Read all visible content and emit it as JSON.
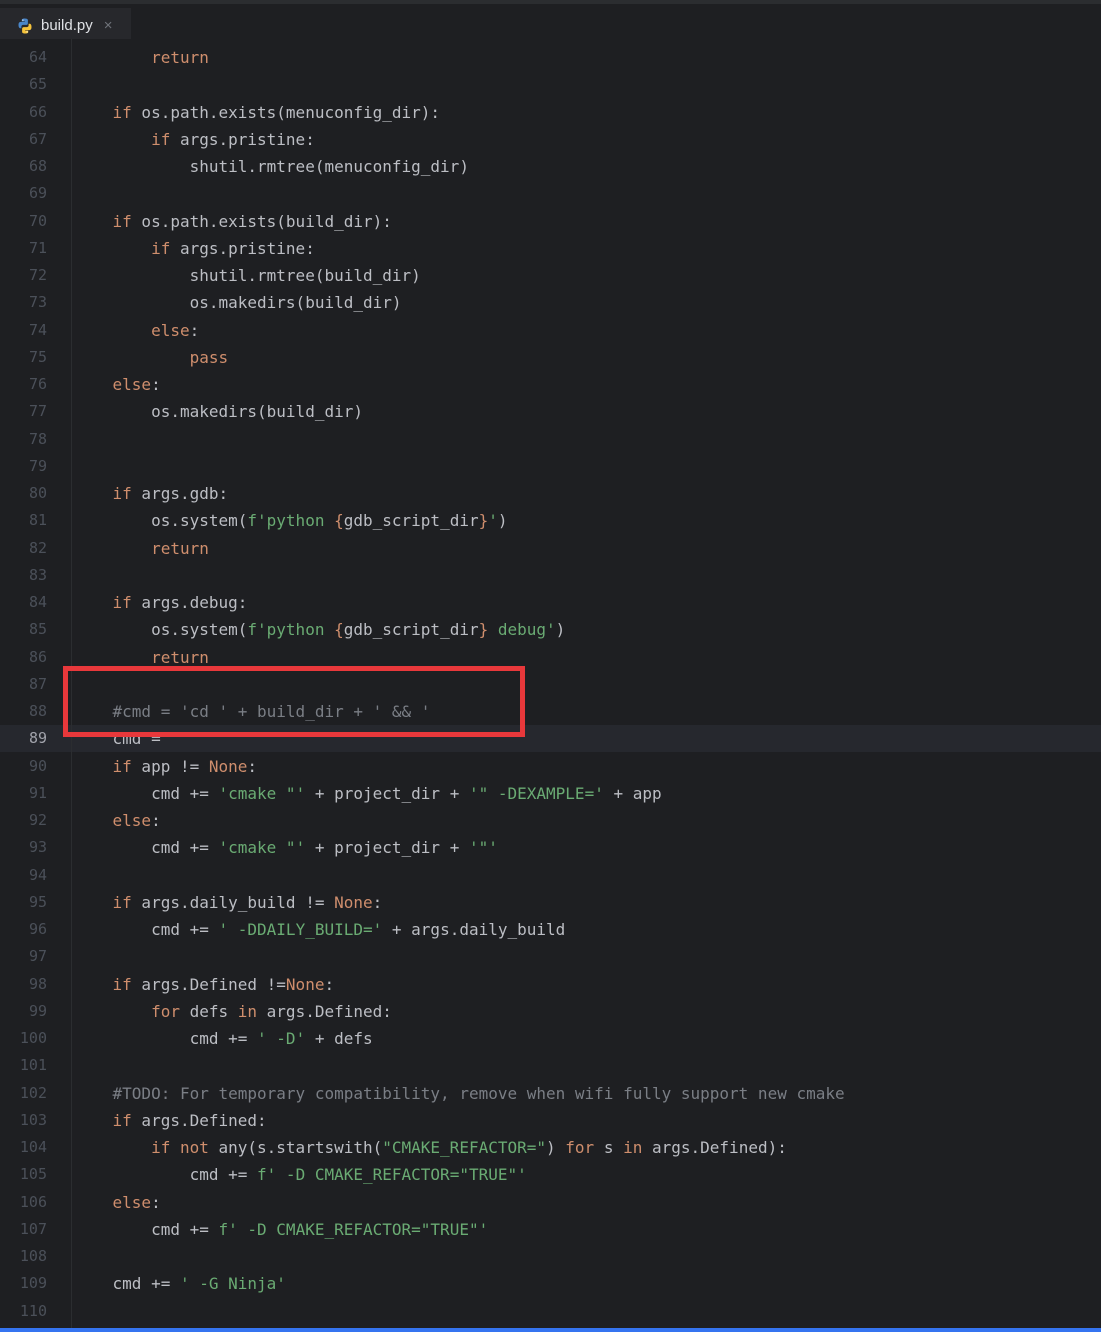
{
  "tab": {
    "file_name": "build.py",
    "close_glyph": "×",
    "icon": "python-icon"
  },
  "editor": {
    "current_line": 89,
    "lines": [
      {
        "n": "64",
        "code": [
          [
            "kw",
            "        return"
          ]
        ]
      },
      {
        "n": "65",
        "code": []
      },
      {
        "n": "66",
        "code": [
          [
            "kw",
            "    if"
          ],
          [
            "op",
            " os.path.exists(menuconfig_dir):"
          ]
        ]
      },
      {
        "n": "67",
        "code": [
          [
            "kw",
            "        if"
          ],
          [
            "op",
            " args.pristine:"
          ]
        ]
      },
      {
        "n": "68",
        "code": [
          [
            "op",
            "            shutil.rmtree(menuconfig_dir)"
          ]
        ]
      },
      {
        "n": "69",
        "code": []
      },
      {
        "n": "70",
        "code": [
          [
            "kw",
            "    if"
          ],
          [
            "op",
            " os.path.exists(build_dir):"
          ]
        ]
      },
      {
        "n": "71",
        "code": [
          [
            "kw",
            "        if"
          ],
          [
            "op",
            " args.pristine:"
          ]
        ]
      },
      {
        "n": "72",
        "code": [
          [
            "op",
            "            shutil.rmtree(build_dir)"
          ]
        ]
      },
      {
        "n": "73",
        "code": [
          [
            "op",
            "            os.makedirs(build_dir)"
          ]
        ]
      },
      {
        "n": "74",
        "code": [
          [
            "kw",
            "        else"
          ],
          [
            "op",
            ":"
          ]
        ]
      },
      {
        "n": "75",
        "code": [
          [
            "kw",
            "            pass"
          ]
        ]
      },
      {
        "n": "76",
        "code": [
          [
            "kw",
            "    else"
          ],
          [
            "op",
            ":"
          ]
        ]
      },
      {
        "n": "77",
        "code": [
          [
            "op",
            "        os.makedirs(build_dir)"
          ]
        ]
      },
      {
        "n": "78",
        "code": []
      },
      {
        "n": "79",
        "code": []
      },
      {
        "n": "80",
        "code": [
          [
            "kw",
            "    if"
          ],
          [
            "op",
            " args.gdb:"
          ]
        ]
      },
      {
        "n": "81",
        "code": [
          [
            "op",
            "        os.system("
          ],
          [
            "str",
            "f'python "
          ],
          [
            "kw",
            "{"
          ],
          [
            "op",
            "gdb_script_dir"
          ],
          [
            "kw",
            "}"
          ],
          [
            "str",
            "'"
          ],
          [
            "op",
            ")"
          ]
        ]
      },
      {
        "n": "82",
        "code": [
          [
            "kw",
            "        return"
          ]
        ]
      },
      {
        "n": "83",
        "code": []
      },
      {
        "n": "84",
        "code": [
          [
            "kw",
            "    if"
          ],
          [
            "op",
            " args.debug:"
          ]
        ]
      },
      {
        "n": "85",
        "code": [
          [
            "op",
            "        os.system("
          ],
          [
            "str",
            "f'python "
          ],
          [
            "kw",
            "{"
          ],
          [
            "op",
            "gdb_script_dir"
          ],
          [
            "kw",
            "}"
          ],
          [
            "str",
            " debug'"
          ],
          [
            "op",
            ")"
          ]
        ]
      },
      {
        "n": "86",
        "code": [
          [
            "kw",
            "        return"
          ]
        ]
      },
      {
        "n": "87",
        "code": []
      },
      {
        "n": "88",
        "code": [
          [
            "cmt",
            "    #cmd = 'cd ' + build_dir + ' && '"
          ]
        ]
      },
      {
        "n": "89",
        "code": [
          [
            "op",
            "    cmd ="
          ]
        ]
      },
      {
        "n": "90",
        "code": [
          [
            "kw",
            "    if"
          ],
          [
            "op",
            " app != "
          ],
          [
            "kw",
            "None"
          ],
          [
            "op",
            ":"
          ]
        ]
      },
      {
        "n": "91",
        "code": [
          [
            "op",
            "        cmd += "
          ],
          [
            "str",
            "'cmake \"'"
          ],
          [
            "op",
            " + project_dir + "
          ],
          [
            "str",
            "'\" -DEXAMPLE='"
          ],
          [
            "op",
            " + app"
          ]
        ]
      },
      {
        "n": "92",
        "code": [
          [
            "kw",
            "    else"
          ],
          [
            "op",
            ":"
          ]
        ]
      },
      {
        "n": "93",
        "code": [
          [
            "op",
            "        cmd += "
          ],
          [
            "str",
            "'cmake \"'"
          ],
          [
            "op",
            " + project_dir + "
          ],
          [
            "str",
            "'\"'"
          ]
        ]
      },
      {
        "n": "94",
        "code": []
      },
      {
        "n": "95",
        "code": [
          [
            "kw",
            "    if"
          ],
          [
            "op",
            " args.daily_build != "
          ],
          [
            "kw",
            "None"
          ],
          [
            "op",
            ":"
          ]
        ]
      },
      {
        "n": "96",
        "code": [
          [
            "op",
            "        cmd += "
          ],
          [
            "str",
            "' -DDAILY_BUILD='"
          ],
          [
            "op",
            " + args.daily_build"
          ]
        ]
      },
      {
        "n": "97",
        "code": []
      },
      {
        "n": "98",
        "code": [
          [
            "kw",
            "    if"
          ],
          [
            "op",
            " args.Defined !="
          ],
          [
            "kw",
            "None"
          ],
          [
            "op",
            ":"
          ]
        ]
      },
      {
        "n": "99",
        "code": [
          [
            "kw",
            "        for"
          ],
          [
            "op",
            " defs "
          ],
          [
            "kw",
            "in"
          ],
          [
            "op",
            " args.Defined:"
          ]
        ]
      },
      {
        "n": "100",
        "code": [
          [
            "op",
            "            cmd += "
          ],
          [
            "str",
            "' -D'"
          ],
          [
            "op",
            " + defs"
          ]
        ]
      },
      {
        "n": "101",
        "code": []
      },
      {
        "n": "102",
        "code": [
          [
            "cmt",
            "    #TODO: For temporary compatibility, remove when wifi fully support new cmake"
          ]
        ]
      },
      {
        "n": "103",
        "code": [
          [
            "kw",
            "    if"
          ],
          [
            "op",
            " args.Defined:"
          ]
        ]
      },
      {
        "n": "104",
        "code": [
          [
            "kw",
            "        if not"
          ],
          [
            "op",
            " any(s.startswith("
          ],
          [
            "str",
            "\"CMAKE_REFACTOR=\""
          ],
          [
            "op",
            ") "
          ],
          [
            "kw",
            "for"
          ],
          [
            "op",
            " s "
          ],
          [
            "kw",
            "in"
          ],
          [
            "op",
            " args.Defined):"
          ]
        ]
      },
      {
        "n": "105",
        "code": [
          [
            "op",
            "            cmd += "
          ],
          [
            "str",
            "f' -D CMAKE_REFACTOR=\"TRUE\"'"
          ]
        ]
      },
      {
        "n": "106",
        "code": [
          [
            "kw",
            "    else"
          ],
          [
            "op",
            ":"
          ]
        ]
      },
      {
        "n": "107",
        "code": [
          [
            "op",
            "        cmd += "
          ],
          [
            "str",
            "f' -D CMAKE_REFACTOR=\"TRUE\"'"
          ]
        ]
      },
      {
        "n": "108",
        "code": []
      },
      {
        "n": "109",
        "code": [
          [
            "op",
            "    cmd += "
          ],
          [
            "str",
            "' -G Ninja'"
          ]
        ]
      },
      {
        "n": "110",
        "code": []
      }
    ]
  },
  "colors": {
    "background": "#1e1f22",
    "keyword": "#cf8e6d",
    "string": "#6aab73",
    "comment": "#7a7e85",
    "text": "#bcbec4",
    "annotation_box": "#e8383b"
  }
}
